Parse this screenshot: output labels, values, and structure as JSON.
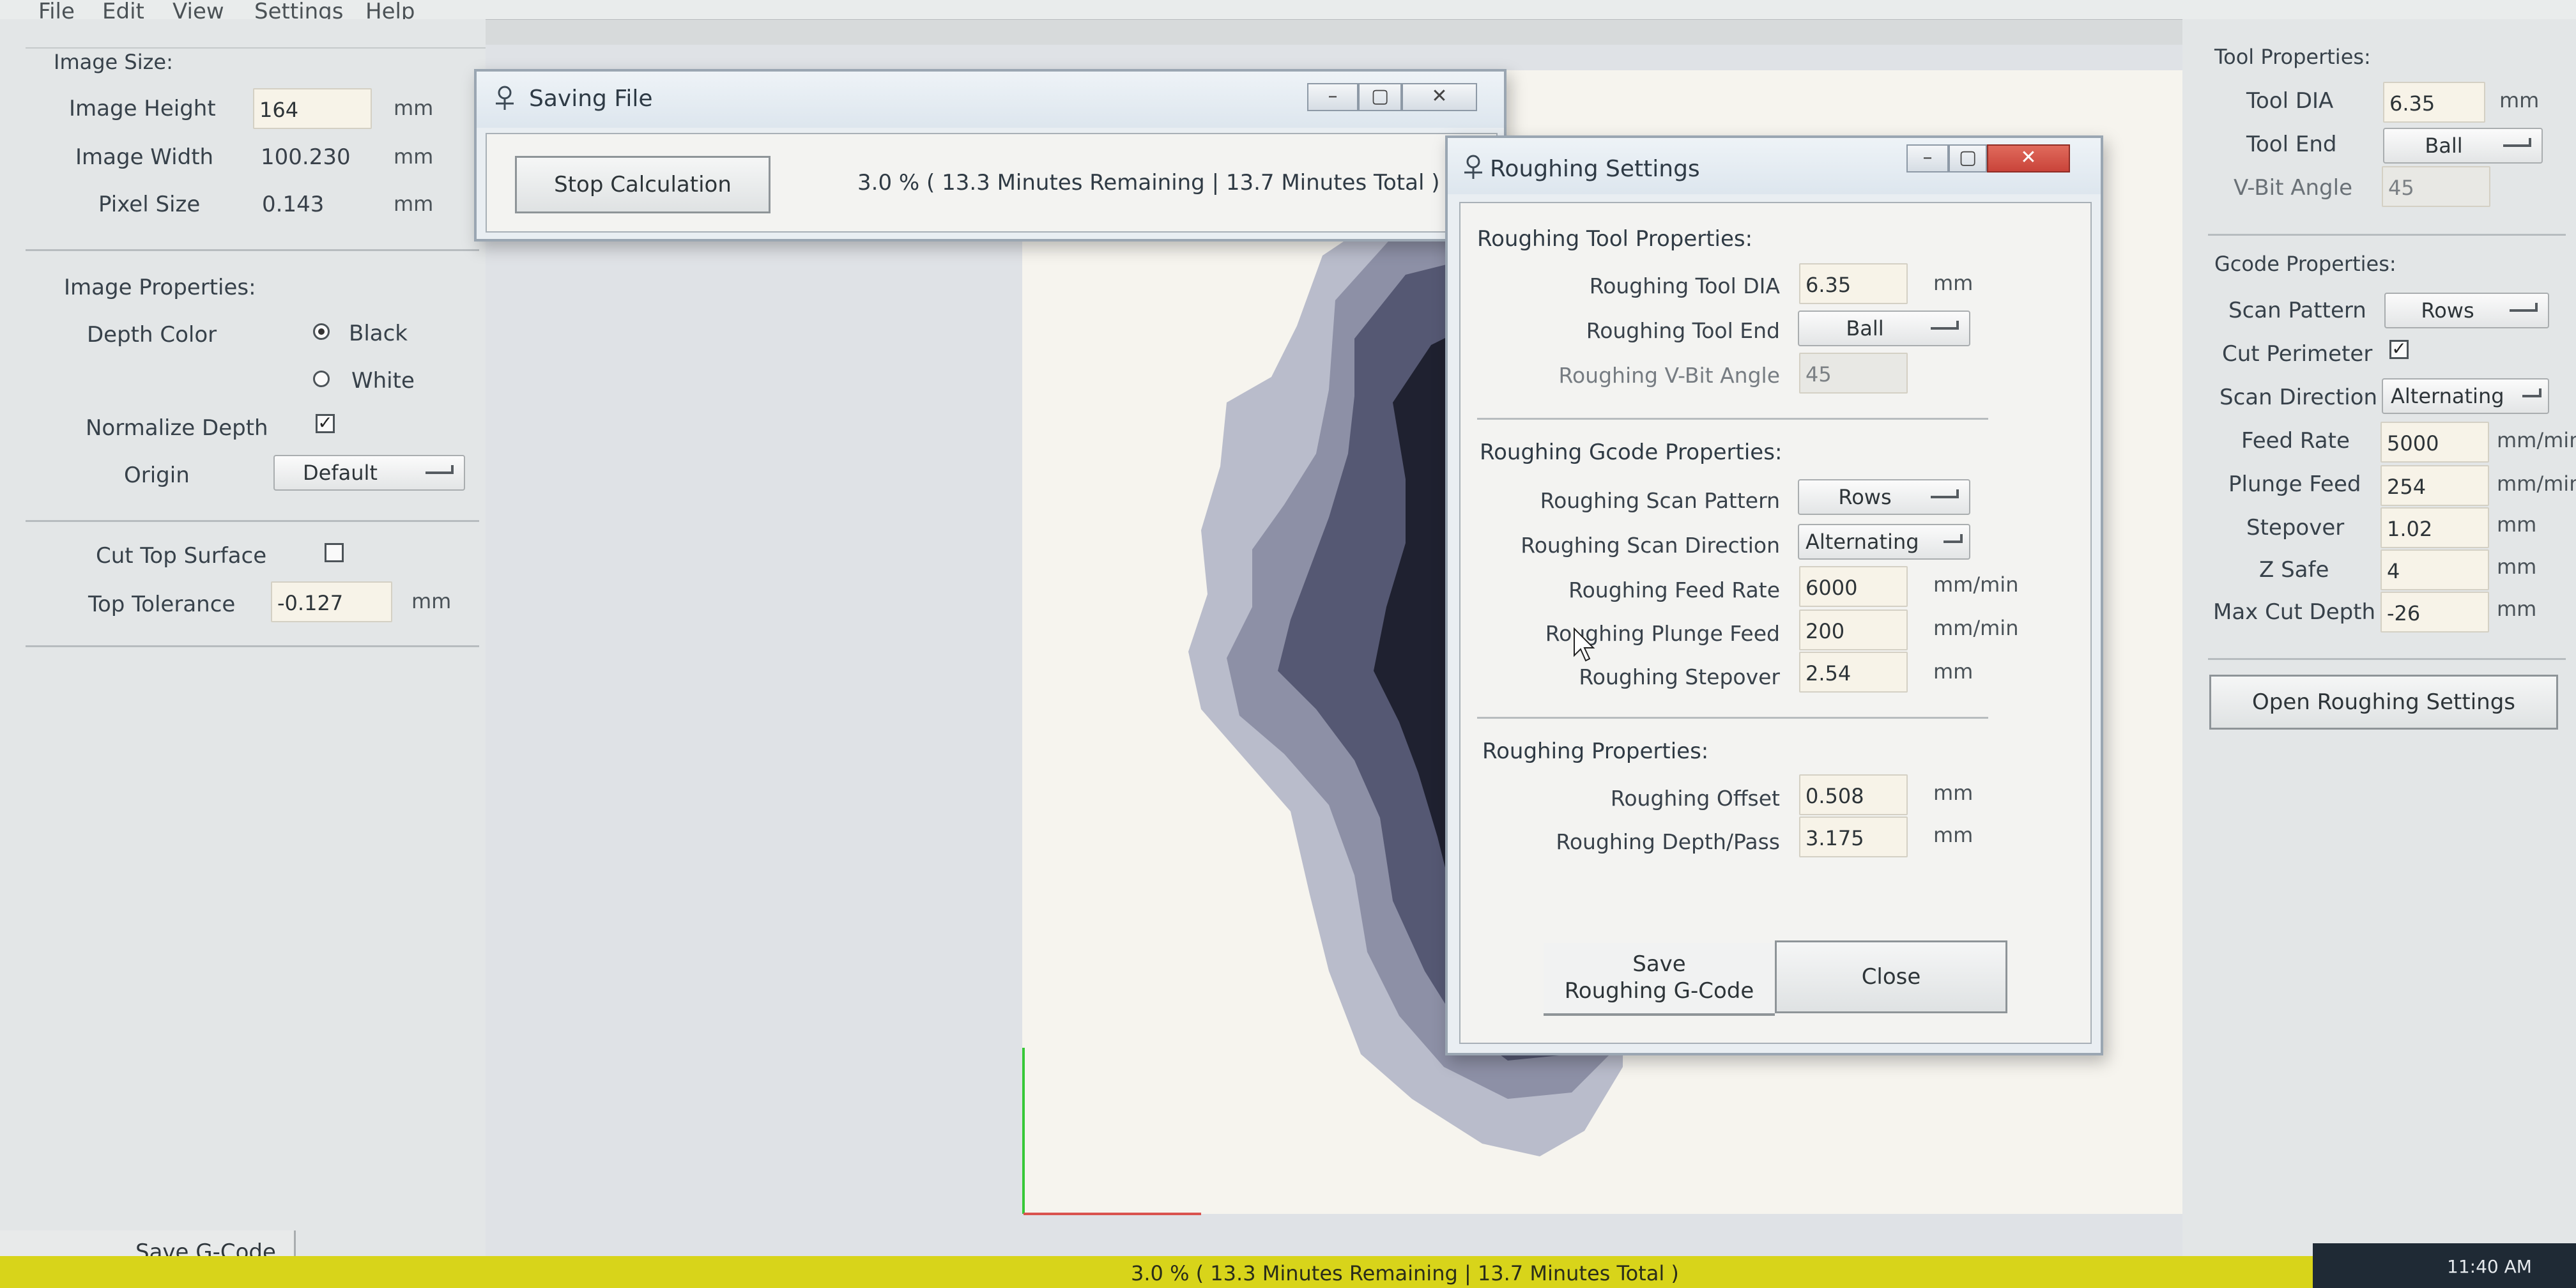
{
  "menu": [
    "File",
    "Edit",
    "View",
    "Settings",
    "Help"
  ],
  "left_panel": {
    "image_size": {
      "heading": "Image Size:",
      "height_label": "Image Height",
      "height_value": "164",
      "height_unit": "mm",
      "width_label": "Image Width",
      "width_value": "100.230",
      "width_unit": "mm",
      "pixel_label": "Pixel Size",
      "pixel_value": "0.143",
      "pixel_unit": "mm"
    },
    "image_properties": {
      "heading": "Image Properties:",
      "depth_color_label": "Depth Color",
      "black_label": "Black",
      "black_selected": true,
      "white_label": "White",
      "normalize_label": "Normalize Depth",
      "normalize_checked": true,
      "origin_label": "Origin",
      "origin_value": "Default"
    },
    "cut_top": {
      "cut_top_label": "Cut Top Surface",
      "cut_top_checked": false,
      "tolerance_label": "Top Tolerance",
      "tolerance_value": "-0.127",
      "tolerance_unit": "mm"
    },
    "save_button": "Save G-Code"
  },
  "right_panel": {
    "tool_heading": "Tool Properties:",
    "tool_dia_label": "Tool DIA",
    "tool_dia_value": "6.35",
    "tool_dia_unit": "mm",
    "tool_end_label": "Tool End",
    "tool_end_value": "Ball",
    "vbit_label": "V-Bit Angle",
    "vbit_value": "45",
    "gcode_heading": "Gcode Properties:",
    "scan_pattern_label": "Scan Pattern",
    "scan_pattern_value": "Rows",
    "cut_perimeter_label": "Cut Perimeter",
    "cut_perimeter_checked": true,
    "scan_direction_label": "Scan Direction",
    "scan_direction_value": "Alternating",
    "feed_rate_label": "Feed Rate",
    "feed_rate_value": "5000",
    "feed_rate_unit": "mm/min",
    "plunge_label": "Plunge Feed",
    "plunge_value": "254",
    "plunge_unit": "mm/min",
    "stepover_label": "Stepover",
    "stepover_value": "1.02",
    "stepover_unit": "mm",
    "zsafe_label": "Z Safe",
    "zsafe_value": "4",
    "zsafe_unit": "mm",
    "max_cut_label": "Max Cut Depth",
    "max_cut_value": "-26",
    "max_cut_unit": "mm",
    "open_roughing_button": "Open Roughing Settings"
  },
  "saving_dialog": {
    "title": "Saving File",
    "stop_button": "Stop Calculation",
    "progress_text": "3.0 % ( 13.3 Minutes Remaining | 13.7 Minutes Total )",
    "progress_fraction": 0.03
  },
  "roughing_dialog": {
    "title": "Roughing Settings",
    "tool_heading": "Roughing Tool Properties:",
    "tool_dia_label": "Roughing Tool DIA",
    "tool_dia_value": "6.35",
    "tool_dia_unit": "mm",
    "tool_end_label": "Roughing Tool End",
    "tool_end_value": "Ball",
    "vbit_label": "Roughing V-Bit Angle",
    "vbit_value": "45",
    "gcode_heading": "Roughing Gcode Properties:",
    "scan_pattern_label": "Roughing Scan Pattern",
    "scan_pattern_value": "Rows",
    "scan_direction_label": "Roughing Scan Direction",
    "scan_direction_value": "Alternating",
    "feed_rate_label": "Roughing Feed Rate",
    "feed_rate_value": "6000",
    "feed_rate_unit": "mm/min",
    "plunge_label": "Roughing Plunge Feed",
    "plunge_value": "200",
    "plunge_unit": "mm/min",
    "stepover_label": "Roughing Stepover",
    "stepover_value": "2.54",
    "stepover_unit": "mm",
    "props_heading": "Roughing Properties:",
    "offset_label": "Roughing Offset",
    "offset_value": "0.508",
    "offset_unit": "mm",
    "depth_pass_label": "Roughing Depth/Pass",
    "depth_pass_value": "3.175",
    "depth_pass_unit": "mm",
    "save_button_line1": "Save",
    "save_button_line2": "Roughing G-Code",
    "close_button": "Close"
  },
  "status_bar": {
    "text": "3.0 % ( 13.3 Minutes Remaining | 13.7 Minutes Total )",
    "clock": "11:40 AM"
  },
  "colors": {
    "status_bar": "#d8d41a",
    "close_button": "#c9443a",
    "preview_background": "#f6f4ee",
    "axis_x": "#d9534f",
    "axis_y": "#37c837"
  }
}
